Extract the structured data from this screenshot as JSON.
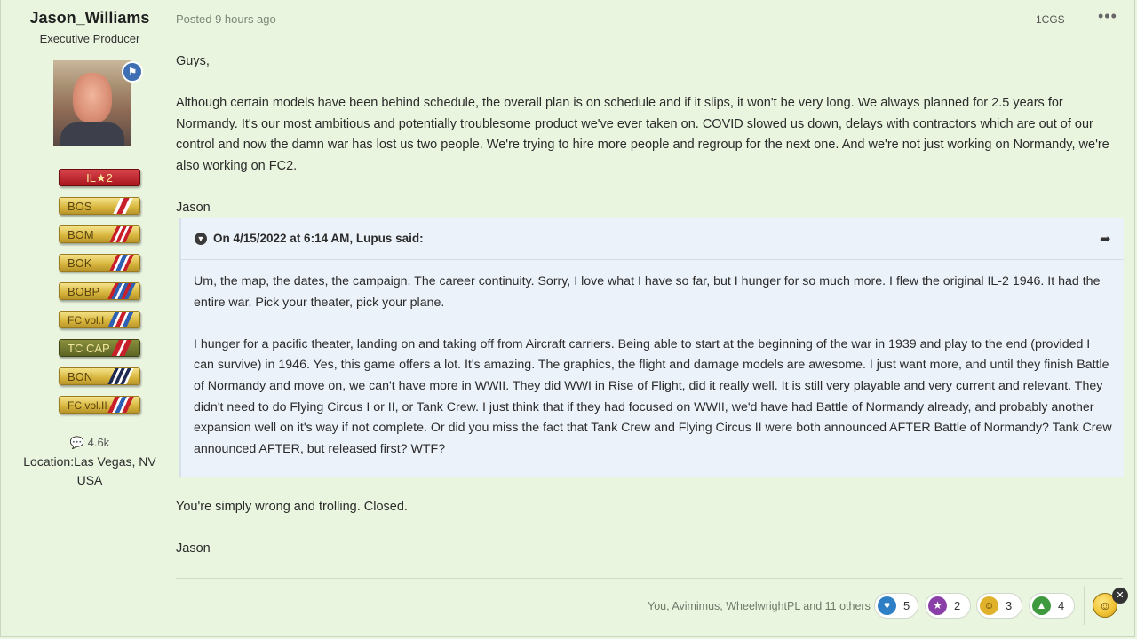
{
  "author": {
    "name": "Jason_Williams",
    "title": "Executive Producer",
    "badges": [
      {
        "label": "IL★2",
        "style": "red"
      },
      {
        "label": "BOS",
        "style": "gold"
      },
      {
        "label": "BOM",
        "style": "gold"
      },
      {
        "label": "BOK",
        "style": "gold"
      },
      {
        "label": "BOBP",
        "style": "gold"
      },
      {
        "label": "FC vol.I",
        "style": "gold"
      },
      {
        "label": "TC CAP",
        "style": "olive"
      },
      {
        "label": "BON",
        "style": "gold"
      },
      {
        "label": "FC vol.II",
        "style": "gold"
      }
    ],
    "post_count": "4.6k",
    "location_label": "Location:",
    "location_value": "Las Vegas, NV USA"
  },
  "post": {
    "meta": "Posted 9 hours ago",
    "group_tag": "1CGS",
    "more_icon": "•••",
    "greeting": "Guys,",
    "paragraph": "Although certain models have been behind schedule, the overall plan is on schedule and if it slips, it won't be very long. We always planned for 2.5 years for Normandy. It's our most ambitious and potentially troublesome product we've ever taken on. COVID slowed us down, delays with contractors which are out of our control and now the damn war has lost us two people. We're trying to hire more people and regroup for the next one. And we're not just working on Normandy, we're also working on FC2.",
    "signature_1": "Jason",
    "quote": {
      "attribution": "On 4/15/2022 at 6:14 AM, Lupus said:",
      "paragraph_1": "Um, the map, the dates, the campaign.  The career continuity.  Sorry, I love what I have so far, but I hunger for so much more.  I flew the original IL-2 1946.  It had the entire war.  Pick your theater, pick your plane.",
      "paragraph_2": "I hunger for a pacific theater, landing on and taking off from Aircraft carriers.  Being able to start at the beginning of the war in 1939 and play to the end (provided I can survive) in 1946.  Yes, this game offers a lot.  It's amazing.  The graphics, the flight and damage models are awesome.  I just want more, and until they finish Battle of Normandy and move on, we can't have more in WWII.  They did WWI in Rise of Flight, did it really well.  It is still very playable and very current and relevant.  They didn't need to do Flying Circus I or II, or Tank Crew.  I just think that if they had focused on WWII, we'd have had Battle of Normandy already, and probably another expansion well on it's way if not complete.  Or did you miss the fact that Tank Crew and Flying Circus II were both announced AFTER Battle of Normandy?  Tank Crew announced AFTER, but released first?  WTF?"
    },
    "reply": "You're simply wrong and trolling. Closed.",
    "signature_2": "Jason"
  },
  "reactions": {
    "reacted_by": "You, Avimimus, WheelwrightPL and 11 others",
    "items": [
      {
        "icon": "heart-icon",
        "count": "5",
        "color": "#2f7fc6"
      },
      {
        "icon": "trophy-icon",
        "count": "2",
        "color": "#8a3fa8"
      },
      {
        "icon": "surprised-face-icon",
        "count": "3",
        "color": "#e0b12a"
      },
      {
        "icon": "upvote-arrow-icon",
        "count": "4",
        "color": "#3f9a3f"
      }
    ]
  }
}
